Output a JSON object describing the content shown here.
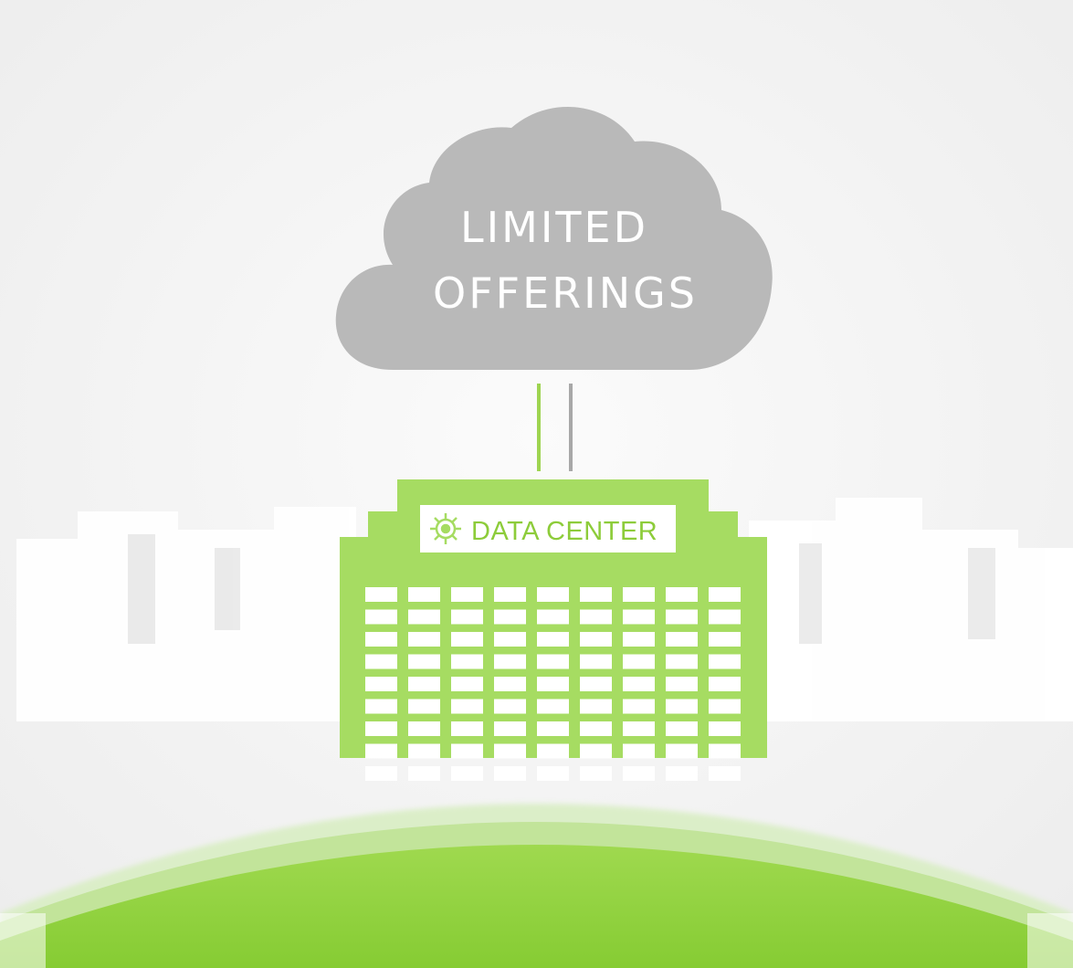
{
  "cloud": {
    "line1": "LIMITED",
    "line2": "OFFERINGS",
    "icon": "cloud-icon"
  },
  "building": {
    "sign_label": "DATA CENTER",
    "sign_icon": "gear-circuit-icon",
    "window_rows": 9,
    "window_cols": 9
  },
  "colors": {
    "background": "#f7f7f7",
    "cloud": "#b8b8b8",
    "building": "#a6dc62",
    "ground": "#8ccf3a",
    "ground_rim": "#c5e6a0",
    "skyline": "#ffffff",
    "connector_green": "#9ed451",
    "connector_gray": "#a8a8a8"
  }
}
